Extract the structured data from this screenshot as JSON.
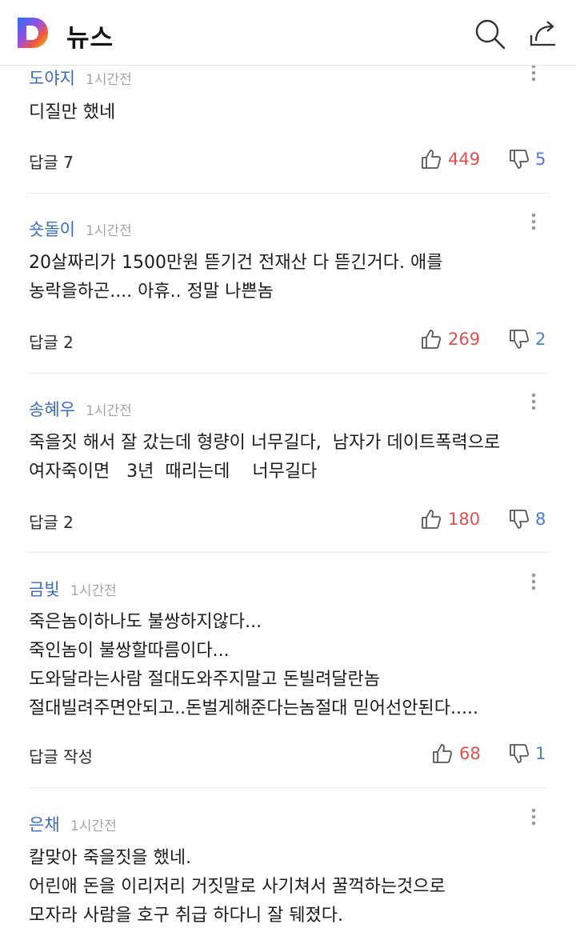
{
  "header": {
    "title": "뉴스",
    "logo_letter": "D",
    "icons": [
      "search-icon",
      "share-icon"
    ]
  },
  "comments": [
    {
      "author": "도야지",
      "time": "1시간전",
      "text": "디질만 했네",
      "reply": "답글 7",
      "likes": "449",
      "dislikes": "5"
    },
    {
      "author": "숏돌이",
      "time": "1시간전",
      "text": "20살짜리가 1500만원 뜯기건 전재산 다 뜯긴거다. 애를\n농락을하곤.... 아휴.. 정말 나쁜놈",
      "reply": "답글 2",
      "likes": "269",
      "dislikes": "2"
    },
    {
      "author": "송혜우",
      "time": "1시간전",
      "text": "죽을짓 해서 잘 갔는데 형량이 너무길다,  남자가 데이트폭력으로\n여자죽이면   3년  때리는데    너무길다",
      "reply": "답글 2",
      "likes": "180",
      "dislikes": "8"
    },
    {
      "author": "금빛",
      "time": "1시간전",
      "text": "죽은놈이하나도 불쌍하지않다...\n죽인놈이 불쌍할따름이다...\n도와달라는사람 절대도와주지말고 돈빌려달란놈\n절대빌려주면안되고..돈벌게해준다는놈절대 믿어선안된다.....",
      "reply": "답글 작성",
      "likes": "68",
      "dislikes": "1"
    },
    {
      "author": "은채",
      "time": "1시간전",
      "text": "칼맞아 죽을짓을 했네.\n어린애 돈을 이리저리 거짓말로 사기쳐서 꿀꺽하는것으로\n모자라 사람을 호구 취급 하다니 잘 뒈졌다."
    }
  ],
  "colors": {
    "author": "#3a6bc0",
    "like": "#e0504d",
    "dislike": "#4b7fd0",
    "time": "#a4a4a4"
  }
}
